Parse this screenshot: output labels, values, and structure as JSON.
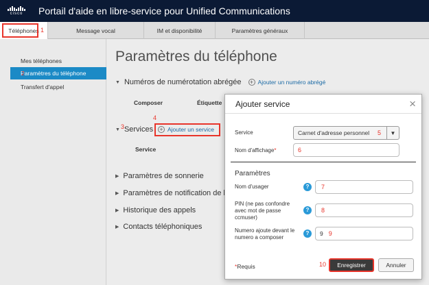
{
  "header": {
    "logo_text": "cisco",
    "app_title": "Portail d'aide en libre-service pour Unified Communications"
  },
  "tabs": [
    {
      "label": "Téléphones",
      "callout": "1"
    },
    {
      "label": "Message vocal"
    },
    {
      "label": "IM et disponibilité"
    },
    {
      "label": "Paramètres généraux"
    }
  ],
  "sidebar": {
    "items": [
      {
        "label": "Mes téléphones"
      },
      {
        "label": "Paramètres du téléphone",
        "callout": "2"
      },
      {
        "label": "Transfert d'appel"
      }
    ]
  },
  "main": {
    "title": "Paramètres du téléphone",
    "speed_dial": {
      "label": "Numéros de numérotation abrégée",
      "add_link": "Ajouter un numéro abrégé",
      "col1": "Composer",
      "col2": "Étiquette"
    },
    "services": {
      "label": "Services",
      "callout": "3",
      "add_link": "Ajouter un service",
      "add_callout": "4",
      "col1": "Service"
    },
    "ringtone": {
      "label": "Paramètres de sonnerie"
    },
    "notification": {
      "label": "Paramètres de notification de l"
    },
    "history": {
      "label": "Historique des appels"
    },
    "contacts": {
      "label": "Contacts téléphoniques"
    }
  },
  "modal": {
    "title": "Ajouter service",
    "close": "×",
    "service_label": "Service",
    "service_value": "Carnet d'adresse personnel",
    "service_callout": "5",
    "display_name_label": "Nom d'affichage",
    "display_name_star": "*",
    "display_name_callout": "6",
    "params_title": "Paramètres",
    "username_label": "Nom d'usager",
    "username_callout": "7",
    "pin_label_1": "PIN (ne pas confondre",
    "pin_label_2": "avec mot de passe",
    "pin_label_3": "ccmuser)",
    "pin_callout": "8",
    "prefix_label_1": "Numero ajoute devant le",
    "prefix_label_2": "numero a composer",
    "prefix_value": "9",
    "prefix_callout": "9",
    "required_star": "*",
    "required_label": "Requis",
    "save_callout": "10",
    "save_label": "Enregistrer",
    "cancel_label": "Annuler",
    "help_glyph": "?"
  }
}
